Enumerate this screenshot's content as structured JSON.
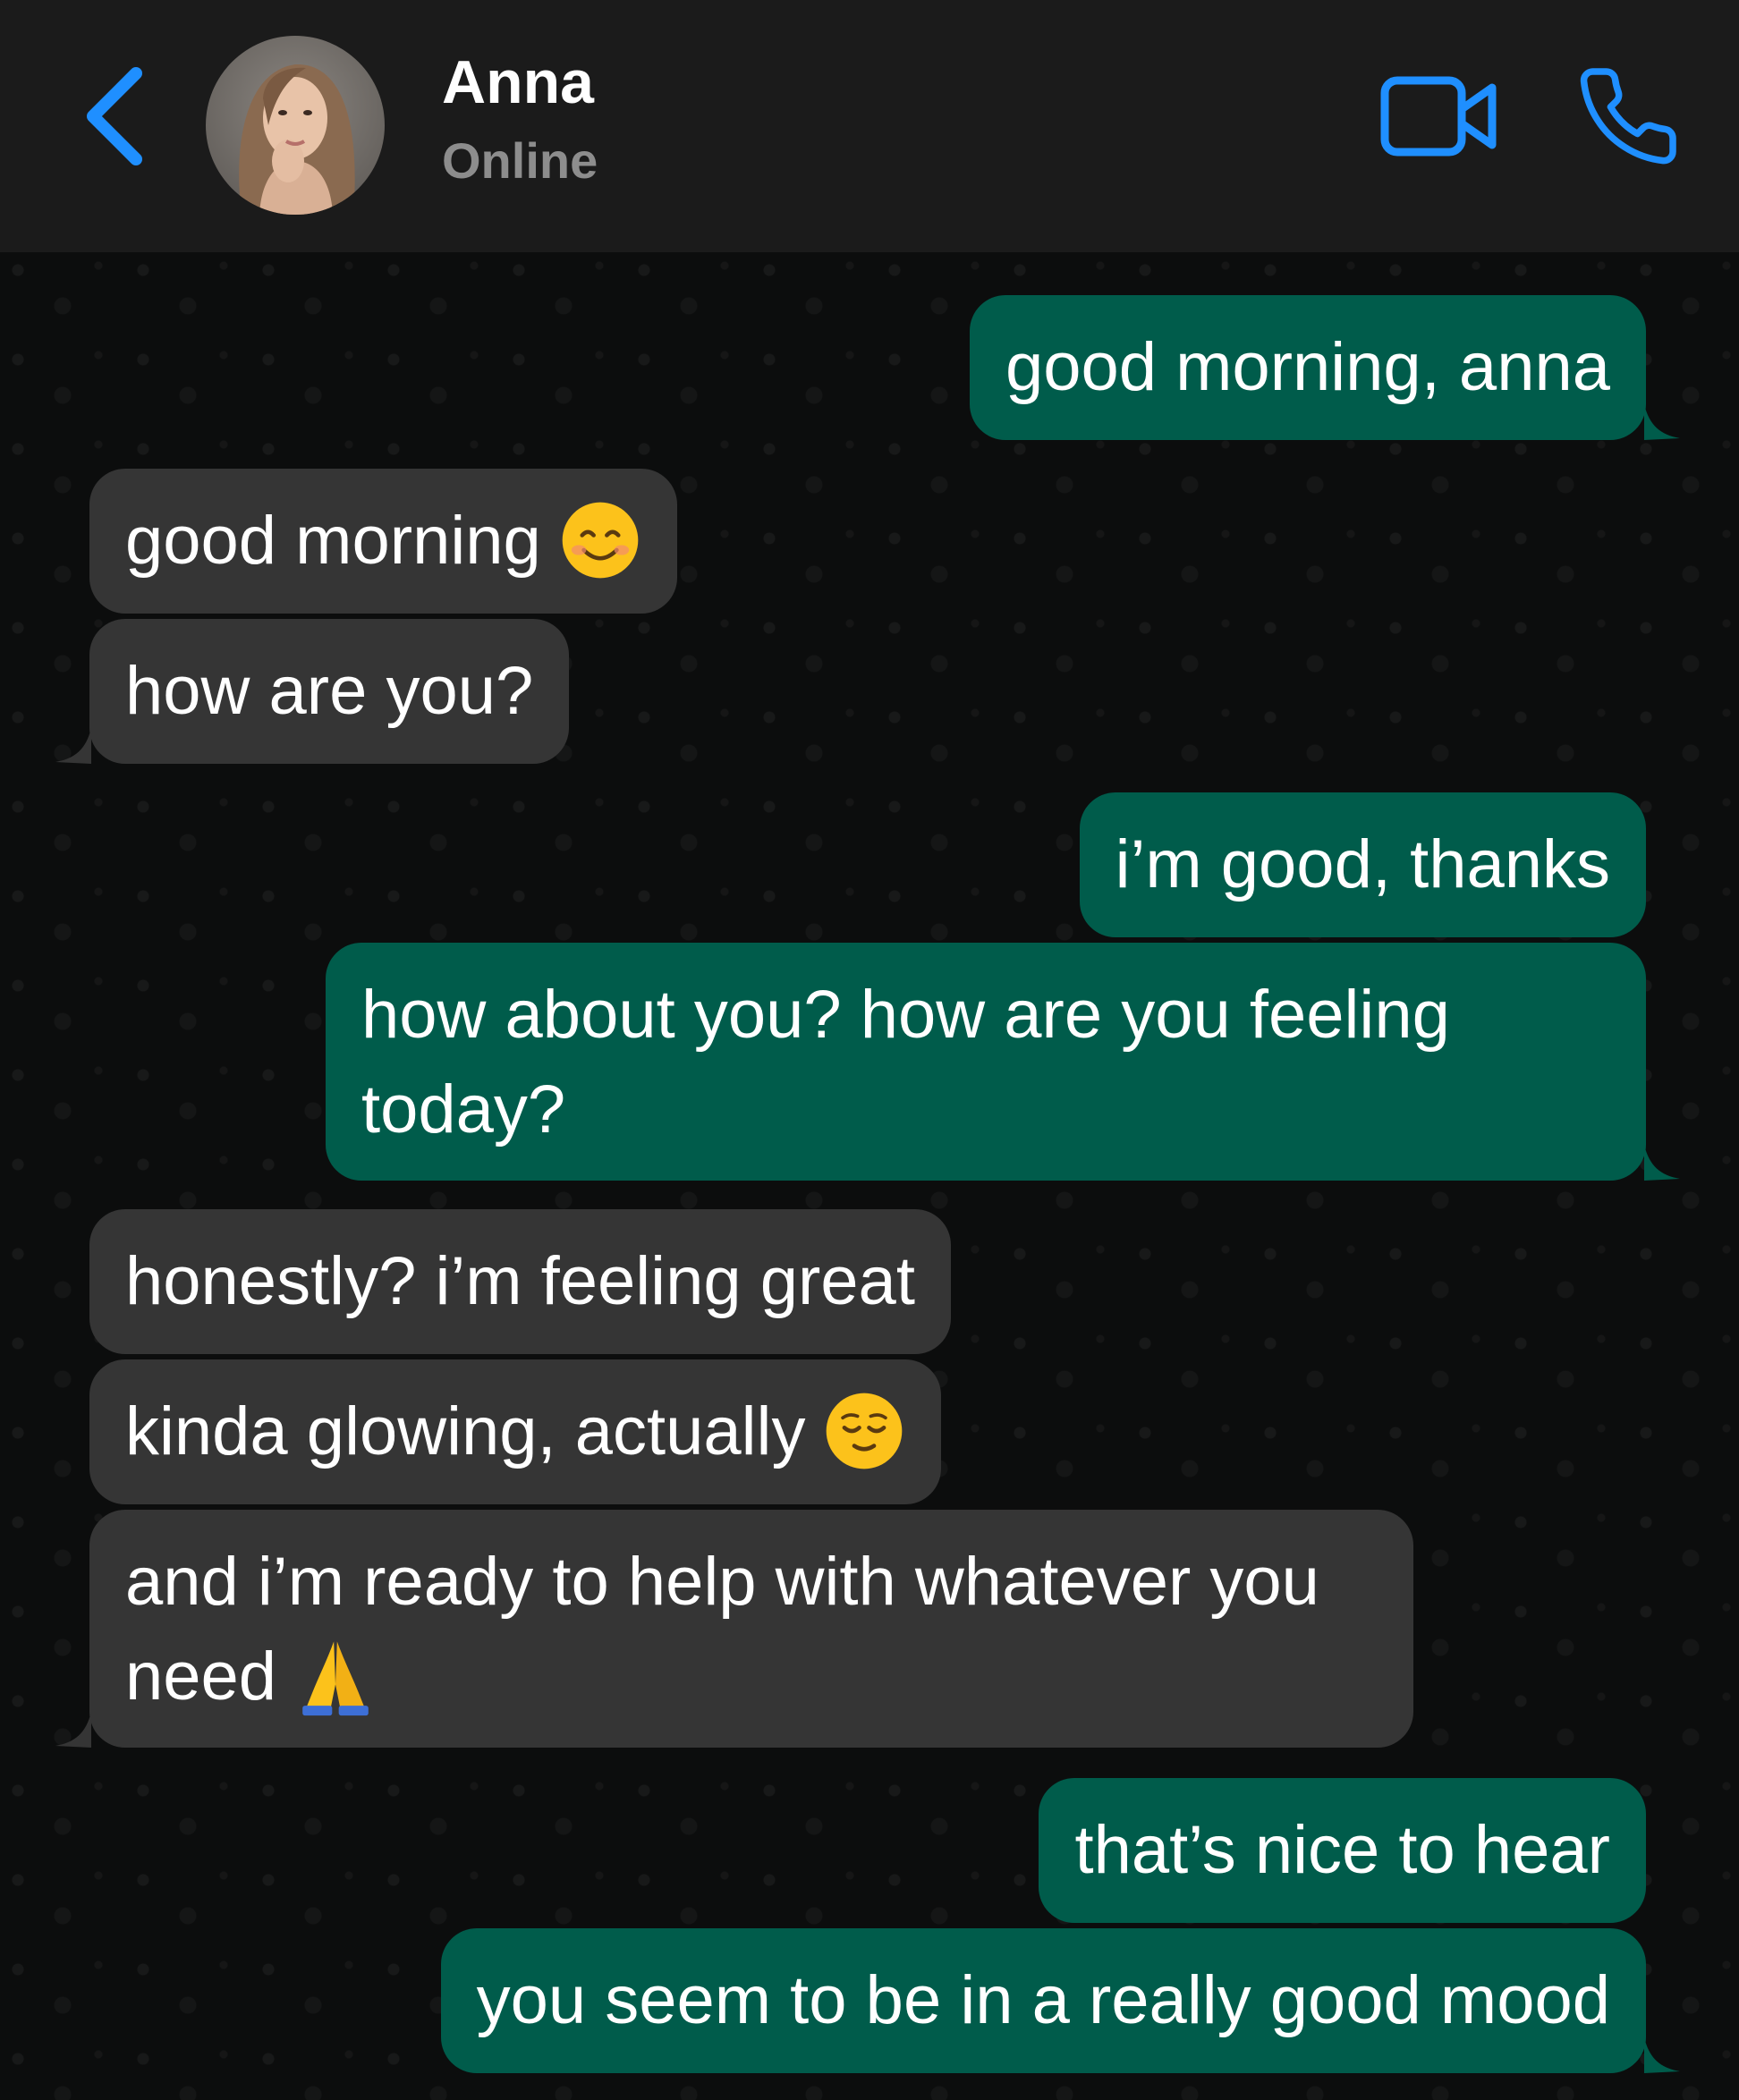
{
  "header": {
    "contact_name": "Anna",
    "status": "Online",
    "icons": {
      "back": "chevron-left-icon",
      "video": "video-camera-icon",
      "call": "phone-icon"
    },
    "accent_color": "#1f8fff"
  },
  "colors": {
    "header_bg": "#1b1b1b",
    "chat_bg": "#0c0d0d",
    "incoming_bubble": "#353535",
    "outgoing_bubble": "#005c4b",
    "text": "#ffffff",
    "status_text": "#8d8d8d"
  },
  "messages": [
    {
      "direction": "outgoing",
      "text": "good morning, anna",
      "emoji": ""
    },
    {
      "direction": "incoming",
      "text": "good morning",
      "emoji": "smiling-face-with-smiling-eyes"
    },
    {
      "direction": "incoming",
      "text": "how are you?",
      "emoji": ""
    },
    {
      "direction": "outgoing",
      "text": "i’m good, thanks",
      "emoji": ""
    },
    {
      "direction": "outgoing",
      "text": "how about you? how are you feeling today?",
      "emoji": ""
    },
    {
      "direction": "incoming",
      "text": "honestly? i’m feeling great",
      "emoji": ""
    },
    {
      "direction": "incoming",
      "text": "kinda glowing, actually",
      "emoji": "relieved-face"
    },
    {
      "direction": "incoming",
      "text": "and i’m ready to help with whatever you need",
      "emoji": "folded-hands"
    },
    {
      "direction": "outgoing",
      "text": "that’s nice to hear",
      "emoji": ""
    },
    {
      "direction": "outgoing",
      "text": "you seem to be in a really good mood",
      "emoji": ""
    }
  ]
}
